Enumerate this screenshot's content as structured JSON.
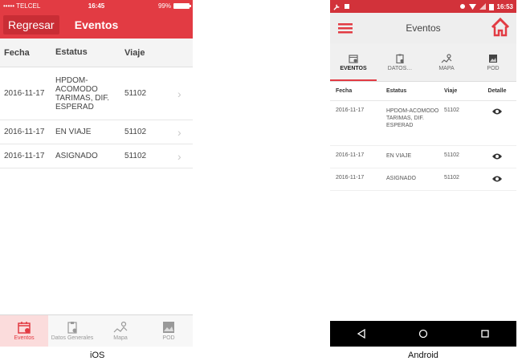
{
  "ios": {
    "status": {
      "carrier": "••••• TELCEL",
      "time": "16:45",
      "battery": "99%"
    },
    "nav": {
      "back": "Regresar",
      "title": "Eventos"
    },
    "columns": [
      "Fecha",
      "Estatus",
      "Viaje"
    ],
    "rows": [
      {
        "fecha": "2016-11-17",
        "estatus": "HPDOM-ACOMODO TARIMAS, DIF. ESPERAD",
        "viaje": "51102"
      },
      {
        "fecha": "2016-11-17",
        "estatus": "EN VIAJE",
        "viaje": "51102"
      },
      {
        "fecha": "2016-11-17",
        "estatus": "ASIGNADO",
        "viaje": "51102"
      }
    ],
    "tabs": [
      {
        "label": "Eventos",
        "icon": "calendar-icon"
      },
      {
        "label": "Datos Generales",
        "icon": "clipboard-icon"
      },
      {
        "label": "Mapa",
        "icon": "map-icon"
      },
      {
        "label": "POD",
        "icon": "image-icon"
      }
    ]
  },
  "android": {
    "status": {
      "time": "16:53"
    },
    "toolbar": {
      "title": "Eventos"
    },
    "tabs": [
      {
        "label": "EVENTOS",
        "icon": "calendar-icon"
      },
      {
        "label": "DATOS…",
        "icon": "clipboard-icon"
      },
      {
        "label": "MAPA",
        "icon": "map-icon"
      },
      {
        "label": "POD",
        "icon": "image-icon"
      }
    ],
    "columns": [
      "Fecha",
      "Estatus",
      "Viaje",
      "Detalle"
    ],
    "rows": [
      {
        "fecha": "2016-11-17",
        "estatus": "HPDOM-ACOMODO TARIMAS, DIF. ESPERAD",
        "viaje": "51102"
      },
      {
        "fecha": "2016-11-17",
        "estatus": "EN VIAJE",
        "viaje": "51102"
      },
      {
        "fecha": "2016-11-17",
        "estatus": "ASIGNADO",
        "viaje": "51102"
      }
    ]
  },
  "captions": {
    "ios": "iOS",
    "android": "Android"
  },
  "colors": {
    "accent": "#e23b43",
    "android_status": "#d2323a"
  }
}
